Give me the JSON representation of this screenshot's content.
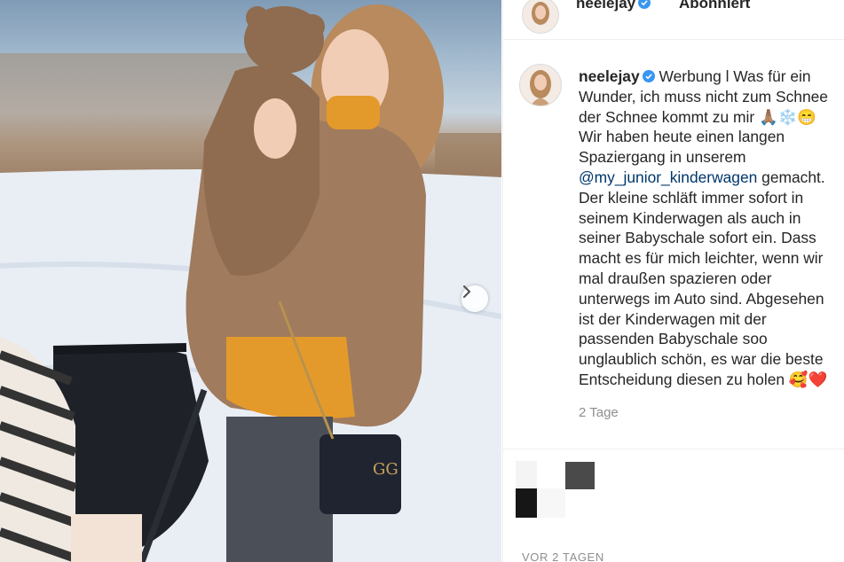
{
  "post": {
    "image_alt": "Photo of woman holding baby in snow"
  },
  "header": {
    "username": "neelejay",
    "follow_label": "Abonniert"
  },
  "caption": {
    "username": "neelejay",
    "lines": [
      "Werbung l Was für ein",
      "Wunder, ich muss nicht zum Schnee",
      "der Schnee kommt zu mir 🙏🏽❄️😁",
      "Wir haben heute einen langen",
      "Spaziergang in unserem",
      "@my_junior_kinderwagen",
      " gemacht.",
      "Der kleine schläft immer sofort in",
      "seinem Kinderwagen als auch in",
      "seiner Babyschale sofort ein. Dass",
      "macht es für mich leichter, wenn wir",
      "mal draußen spazieren oder",
      "unterwegs im Auto sind. Abgesehen",
      "ist der Kinderwagen mit der",
      "passenden Babyschale soo",
      "unglaublich schön, es war die beste",
      "Entscheidung diesen zu holen 🥰❤️"
    ],
    "timestamp": "2 Tage"
  },
  "footer": {
    "date": "VOR 2 TAGEN"
  },
  "colors": {
    "verified": "#3897f0",
    "mention": "#00376b",
    "muted": "#8e8e8e"
  }
}
